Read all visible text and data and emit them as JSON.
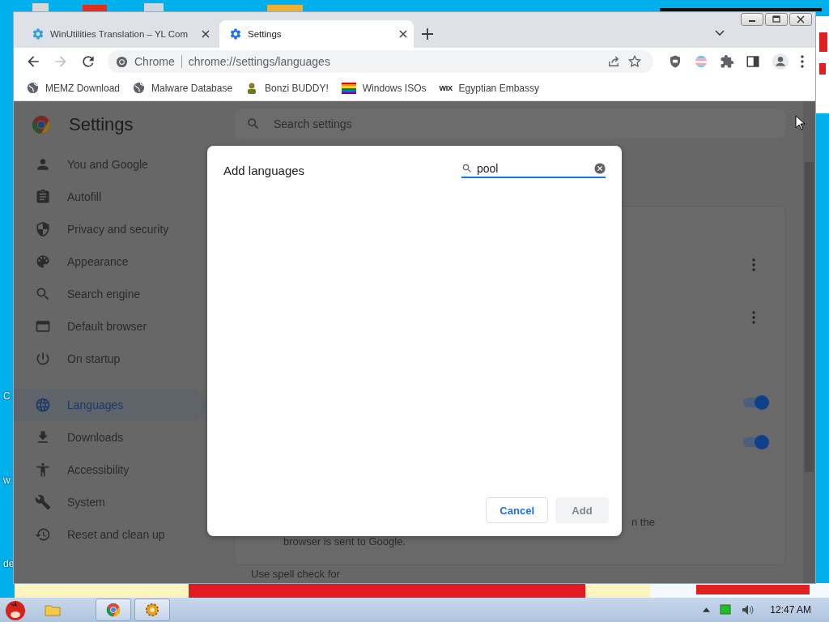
{
  "desktop": {
    "icon_labels": [
      "C",
      "w",
      "de"
    ]
  },
  "browser": {
    "tabs": [
      {
        "title": "WinUtilities Translation – YL Com",
        "selected": false
      },
      {
        "title": "Settings",
        "selected": true
      }
    ],
    "nav": [
      {
        "kind": "back",
        "disabled": false
      },
      {
        "kind": "forward",
        "disabled": true
      },
      {
        "kind": "reload",
        "disabled": false
      }
    ],
    "omnibox": {
      "site_label": "Chrome",
      "url": "chrome://settings/languages"
    },
    "bookmarks": [
      {
        "title": "MEMZ Download"
      },
      {
        "title": "Malware Database"
      },
      {
        "title": "Bonzi BUDDY!"
      },
      {
        "title": "Windows ISOs"
      },
      {
        "title": "Egyptian Embassy",
        "icon_text": "WIX"
      }
    ]
  },
  "settings": {
    "title": "Settings",
    "search": {
      "placeholder": "Search settings"
    },
    "nav": [
      {
        "label": "You and Google",
        "selected": false
      },
      {
        "label": "Autofill",
        "selected": false
      },
      {
        "label": "Privacy and security",
        "selected": false
      },
      {
        "label": "Appearance",
        "selected": false
      },
      {
        "label": "Search engine",
        "selected": false
      },
      {
        "label": "Default browser",
        "selected": false
      },
      {
        "label": "On startup",
        "selected": false
      },
      {
        "label": "Languages",
        "selected": true
      },
      {
        "label": "Downloads",
        "selected": false
      },
      {
        "label": "Accessibility",
        "selected": false
      },
      {
        "label": "System",
        "selected": false
      },
      {
        "label": "Reset and clean up",
        "selected": false
      }
    ],
    "rows": [
      {
        "kind": "menu"
      },
      {
        "kind": "menu"
      },
      {
        "kind": "toggle",
        "on": true
      },
      {
        "kind": "toggle",
        "on": true
      }
    ],
    "line_tail": "n the",
    "line": "browser is sent to Google.",
    "spellcheck_heading": "Use spell check for"
  },
  "dialog": {
    "title": "Add languages",
    "search": {
      "value": "pool"
    },
    "buttons": [
      {
        "label": "Cancel",
        "disabled": false
      },
      {
        "label": "Add",
        "disabled": true
      }
    ]
  },
  "taskbar": {
    "apps": [
      {
        "kind": "folder",
        "running": false
      },
      {
        "kind": "chrome",
        "running": true
      },
      {
        "kind": "gear",
        "running": true
      }
    ],
    "clock": "12:47 AM"
  }
}
